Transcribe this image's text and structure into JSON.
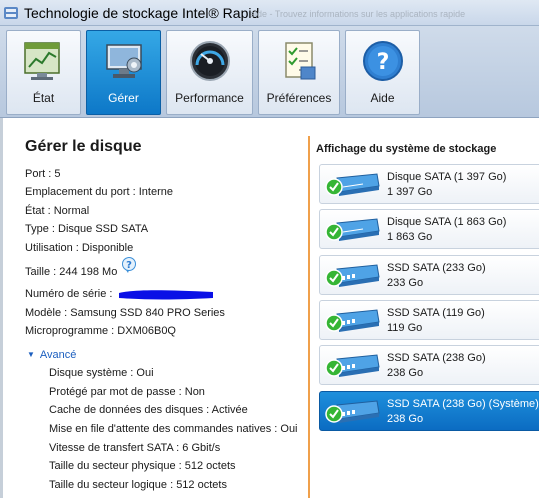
{
  "window": {
    "title": "Technologie de stockage Intel® Rapid",
    "background_text": "aide - Trouvez informations sur les applications rapide"
  },
  "tabs": [
    {
      "label": "État",
      "icon": "status-chart-icon",
      "active": false
    },
    {
      "label": "Gérer",
      "icon": "manage-pc-icon",
      "active": true
    },
    {
      "label": "Performance",
      "icon": "gauge-icon",
      "active": false
    },
    {
      "label": "Préférences",
      "icon": "checklist-icon",
      "active": false
    },
    {
      "label": "Aide",
      "icon": "help-icon",
      "active": false
    }
  ],
  "disk_details": {
    "heading": "Gérer le disque",
    "port": "Port : 5",
    "port_location": "Emplacement du port : Interne",
    "state": "État : Normal",
    "type": "Type : Disque SSD SATA",
    "usage": "Utilisation : Disponible",
    "size": "Taille : 244 198 Mo",
    "serial": "Numéro de série :",
    "model": "Modèle : Samsung SSD 840 PRO Series",
    "firmware": "Microprogramme : DXM06B0Q"
  },
  "advanced": {
    "label": "Avancé",
    "rows": [
      "Disque système : Oui",
      "Protégé par mot de passe : Non",
      "Cache de données des disques : Activée",
      "Mise en file d'attente des commandes natives : Oui",
      "Vitesse de transfert SATA : 6 Gbit/s",
      "Taille du secteur physique : 512 octets",
      "Taille du secteur logique : 512 octets"
    ]
  },
  "storage_view": {
    "title": "Affichage du système de stockage",
    "disks": [
      {
        "name": "Disque SATA (1 397 Go)",
        "size": "1 397 Go",
        "kind": "hdd",
        "selected": false
      },
      {
        "name": "Disque SATA (1 863 Go)",
        "size": "1 863 Go",
        "kind": "hdd",
        "selected": false
      },
      {
        "name": "SSD SATA (233 Go)",
        "size": "233 Go",
        "kind": "ssd",
        "selected": false
      },
      {
        "name": "SSD SATA (119 Go)",
        "size": "119 Go",
        "kind": "ssd",
        "selected": false
      },
      {
        "name": "SSD SATA (238 Go)",
        "size": "238 Go",
        "kind": "ssd",
        "selected": false
      },
      {
        "name": "SSD SATA (238 Go) (Système)",
        "size": "238 Go",
        "kind": "ssd",
        "selected": true
      }
    ]
  },
  "colors": {
    "accent": "#0d78c8",
    "divider": "#f0a04b",
    "link": "#1c5fbf",
    "ok_badge": "#35b535"
  }
}
